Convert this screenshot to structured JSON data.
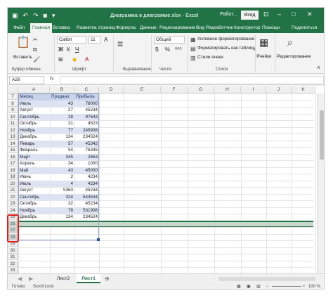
{
  "title_bar": {
    "doc_title": "Диаграмма в диаграмме.xlsx  -  Excel",
    "user": "Работ...",
    "login": "Вход",
    "qat_icons": [
      "save-icon",
      "undo-icon",
      "redo-icon",
      "camera-icon",
      "customize-icon"
    ]
  },
  "tabs": [
    "Файл",
    "Главная",
    "Вставка",
    "Разметка страниц",
    "Формулы",
    "Данные",
    "Рецензирование",
    "Вид",
    "Разработчик",
    "Конструктор",
    "Помощн",
    "Поделиться"
  ],
  "ribbon": {
    "paste": "Вставить",
    "font_name": "Calibri",
    "font_size": "11",
    "number_format": "Общий",
    "cond_format": "Условное форматирование",
    "format_table": "Форматировать как таблицу",
    "cell_styles": "Стили ячеек",
    "cells": "Ячейки",
    "editing": "Редактирование",
    "groups": [
      "Буфер обмена",
      "Шрифт",
      "Выравнивание",
      "Число",
      "Стили"
    ]
  },
  "formula_bar": {
    "name_box": "A26",
    "fx": "fx"
  },
  "grid": {
    "columns": [
      "A",
      "B",
      "C",
      "D",
      "E",
      "F",
      "G",
      "H",
      "I",
      "J",
      "K"
    ],
    "header_row": {
      "row": "7",
      "cells": [
        "Месяц",
        "Продано",
        "Прибыль"
      ]
    },
    "rows": [
      {
        "row": "8",
        "cells": [
          "Июль",
          "43",
          "78000"
        ]
      },
      {
        "row": "9",
        "cells": [
          "Август",
          "27",
          "45234"
        ]
      },
      {
        "row": "10",
        "cells": [
          "Сентябрь",
          "28",
          "97643"
        ]
      },
      {
        "row": "11",
        "cells": [
          "Октябрь",
          "31",
          "4523"
        ]
      },
      {
        "row": "12",
        "cells": [
          "Ноябрь",
          "77",
          "245908"
        ]
      },
      {
        "row": "13",
        "cells": [
          "Декабрь",
          "134",
          "234524"
        ]
      },
      {
        "row": "14",
        "cells": [
          "Январь",
          "57",
          "45342"
        ]
      },
      {
        "row": "15",
        "cells": [
          "Февраль",
          "54",
          "76345"
        ]
      },
      {
        "row": "16",
        "cells": [
          "Март",
          "345",
          "2653"
        ]
      },
      {
        "row": "17",
        "cells": [
          "Апрель",
          "34",
          "1000"
        ]
      },
      {
        "row": "18",
        "cells": [
          "Май",
          "43",
          "45000"
        ]
      },
      {
        "row": "19",
        "cells": [
          "Июнь",
          "2",
          "4234"
        ]
      },
      {
        "row": "20",
        "cells": [
          "Июль",
          "4",
          "4234"
        ]
      },
      {
        "row": "21",
        "cells": [
          "Август",
          "5363",
          "45234"
        ]
      },
      {
        "row": "22",
        "cells": [
          "Сентябрь",
          "324",
          "543534"
        ]
      },
      {
        "row": "23",
        "cells": [
          "Октябрь",
          "32",
          "45234"
        ]
      },
      {
        "row": "24",
        "cells": [
          "Ноябрь",
          "78",
          "531908"
        ]
      },
      {
        "row": "25",
        "cells": [
          "Декабрь",
          "134",
          "234524"
        ]
      },
      {
        "row": "26",
        "cells": [
          "",
          "",
          ""
        ]
      },
      {
        "row": "27",
        "cells": [
          "",
          "",
          ""
        ]
      },
      {
        "row": "28",
        "cells": [
          "",
          "",
          ""
        ]
      },
      {
        "row": "29",
        "cells": [
          "",
          "",
          ""
        ]
      },
      {
        "row": "30",
        "cells": [
          "",
          "",
          ""
        ]
      },
      {
        "row": "31",
        "cells": [
          "",
          "",
          ""
        ]
      },
      {
        "row": "32",
        "cells": [
          "",
          "",
          ""
        ]
      },
      {
        "row": "33",
        "cells": [
          "",
          "",
          ""
        ]
      }
    ]
  },
  "sheets": [
    "Лист2",
    "Лист1"
  ],
  "active_sheet": "Лист1",
  "status": {
    "ready": "Готово",
    "scroll_lock": "Scroll Lock",
    "zoom": "100 %"
  },
  "colors": {
    "excel_green": "#217346",
    "table_band": "#dde3f2",
    "highlight": "#e0201c"
  }
}
